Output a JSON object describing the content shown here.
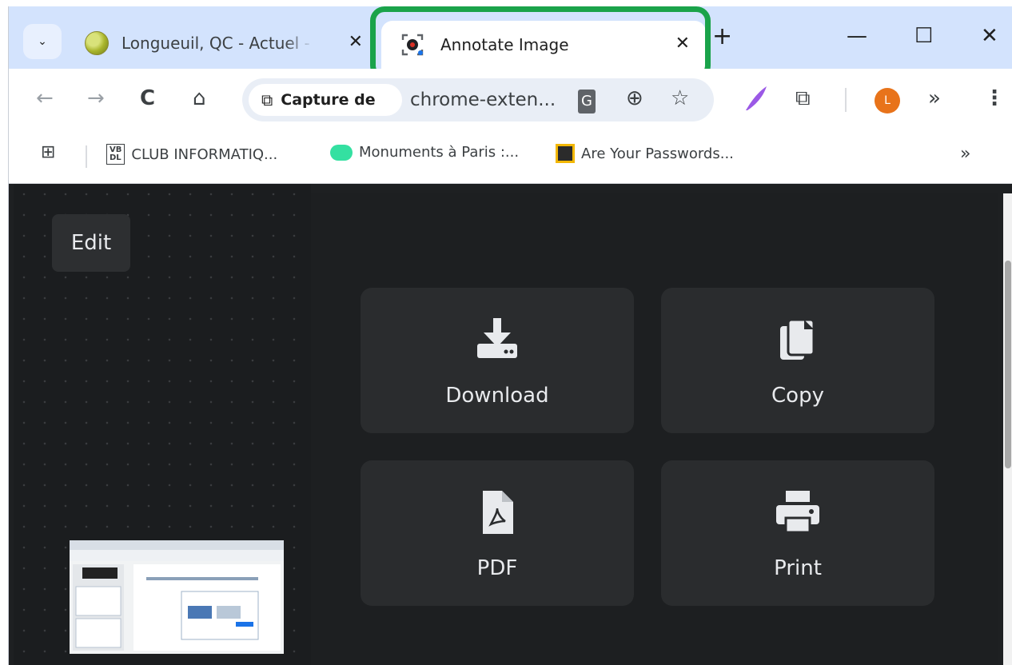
{
  "tabs": [
    {
      "title": "Longueuil, QC - Actuel - Météo",
      "close": "✕"
    },
    {
      "title": "Annotate Image",
      "close": "✕"
    }
  ],
  "window": {
    "minimize": "—",
    "maximize": "☐",
    "close": "✕",
    "new_tab": "+",
    "tab_menu": "⌄"
  },
  "toolbar": {
    "back": "←",
    "forward": "→",
    "reload": "C",
    "home": "⌂",
    "chip_label": "Capture de",
    "url": "chrome-exten...",
    "translate": "G",
    "zoom": "⊕",
    "bookmark_star": "☆",
    "extensions_more": "»",
    "menu": "⋮",
    "avatar_letter": "L"
  },
  "bookmarks": {
    "items": [
      {
        "label": "CLUB INFORMATIQ...",
        "icon_text": "VB\nDL"
      },
      {
        "label": "Monuments à Paris :..."
      },
      {
        "label": "Are Your Passwords..."
      }
    ],
    "more": "»"
  },
  "editor": {
    "edit_label": "Edit",
    "actions": [
      {
        "label": "Download",
        "icon": "download-icon"
      },
      {
        "label": "Copy",
        "icon": "copy-icon"
      },
      {
        "label": "PDF",
        "icon": "pdf-icon"
      },
      {
        "label": "Print",
        "icon": "print-icon"
      }
    ]
  },
  "colors": {
    "titlebar": "#d3e3fd",
    "highlight": "#1aa34a",
    "content_bg": "#1e2022",
    "tile_bg": "#2a2c2e",
    "avatar": "#e8731a"
  }
}
